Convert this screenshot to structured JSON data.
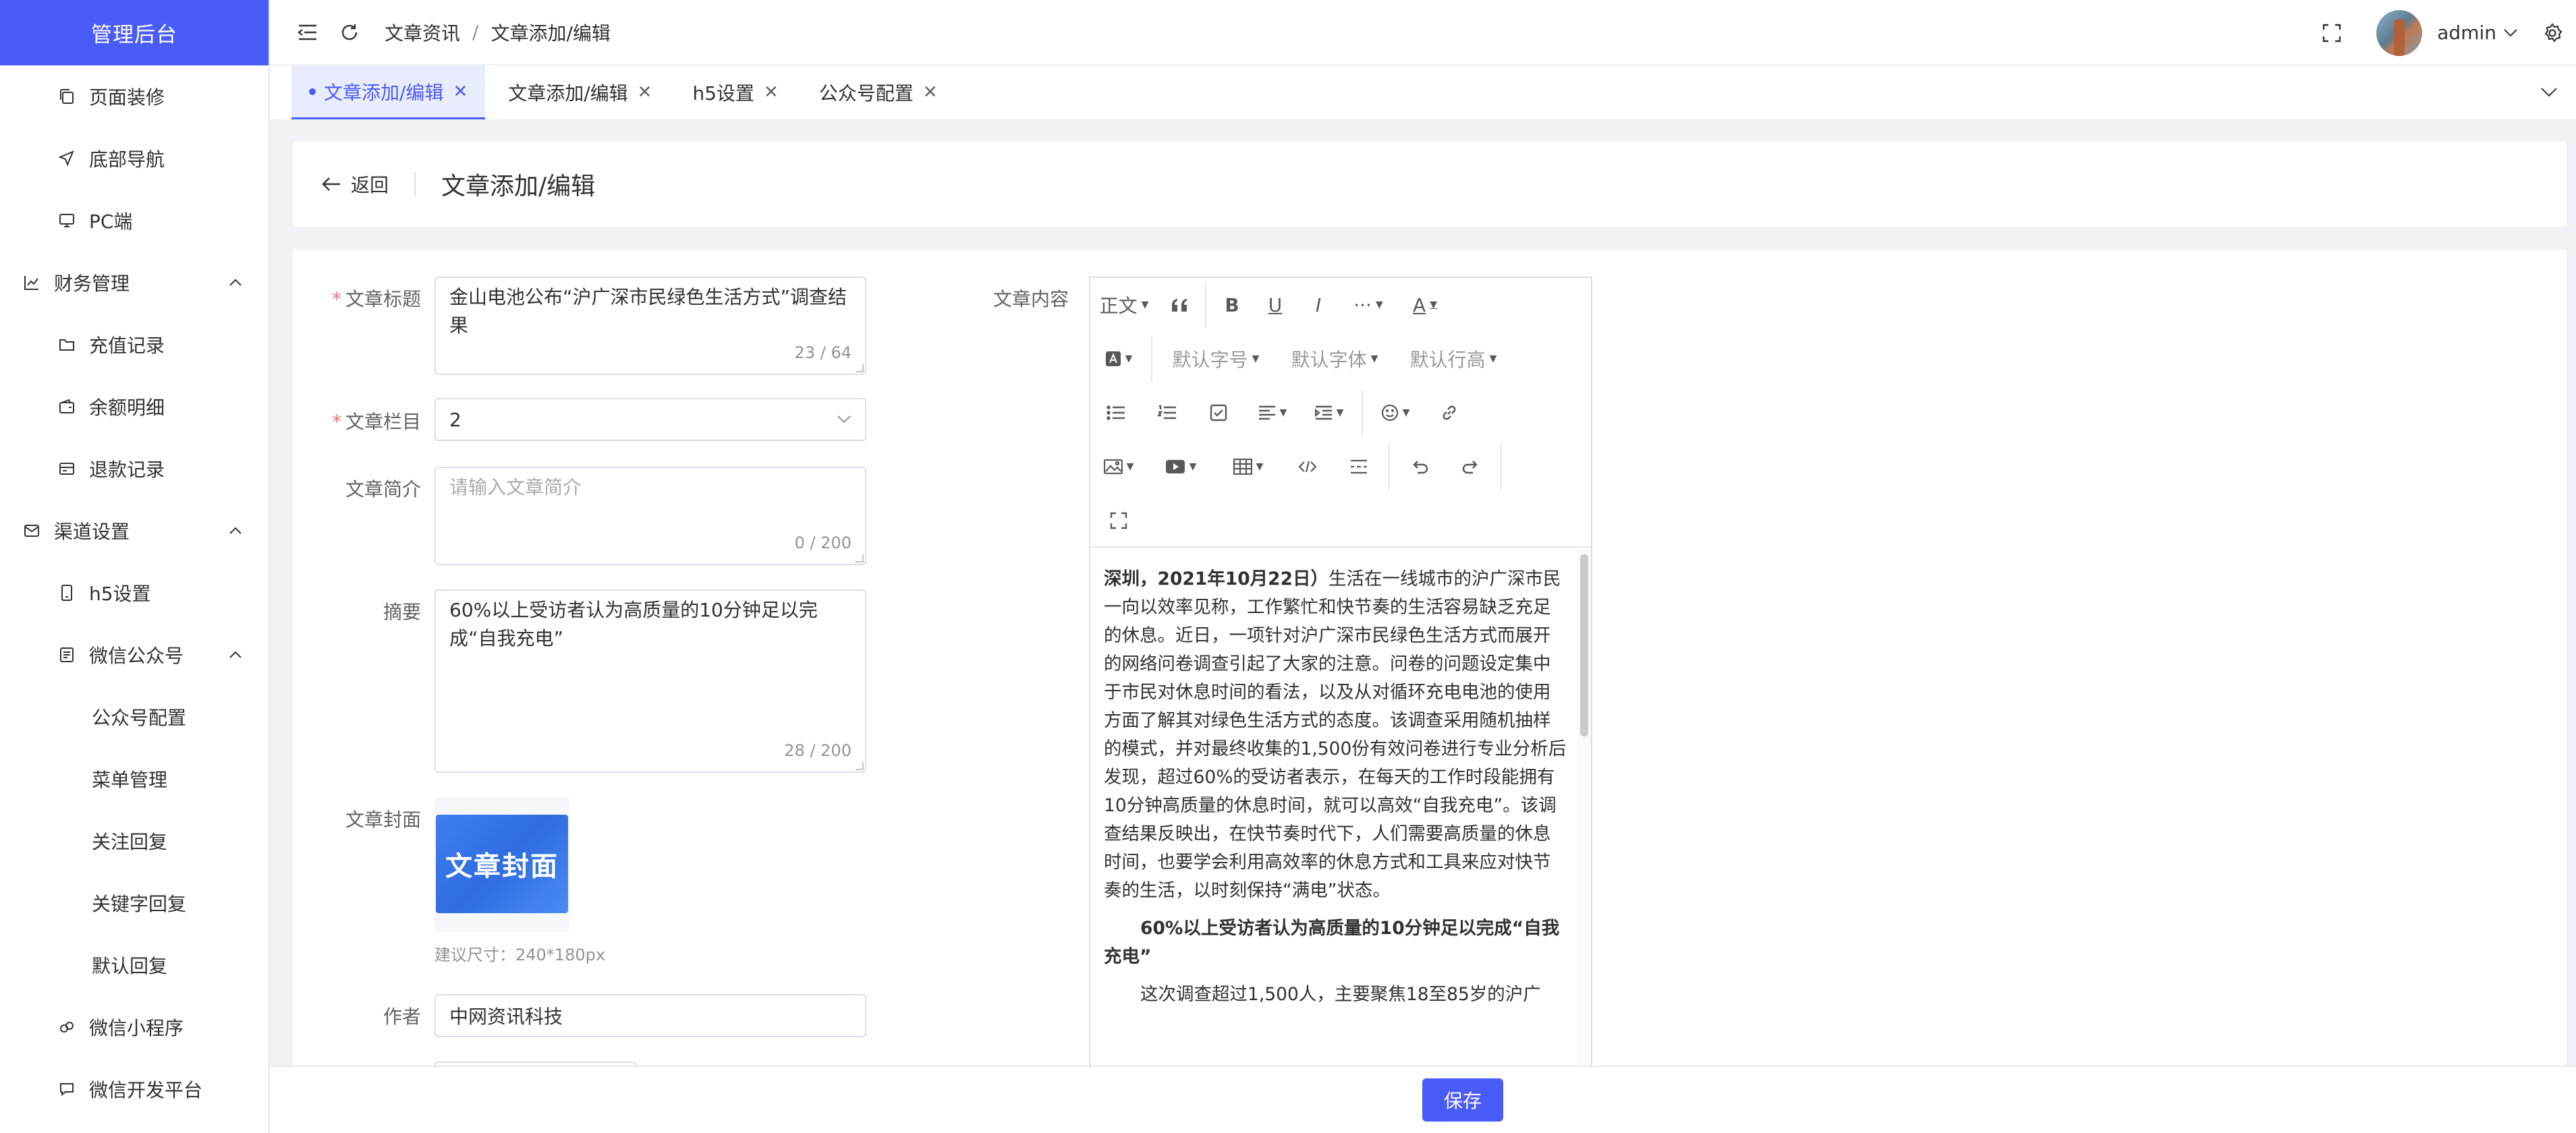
{
  "brand": {
    "title": "管理后台"
  },
  "sidebar": {
    "items": [
      {
        "label": "页面装修",
        "icon": "copy-icon",
        "level": 2
      },
      {
        "label": "底部导航",
        "icon": "navigation-icon",
        "level": 2
      },
      {
        "label": "PC端",
        "icon": "monitor-icon",
        "level": 2
      },
      {
        "label": "财务管理",
        "icon": "chart-icon",
        "level": 1,
        "expanded": true
      },
      {
        "label": "充值记录",
        "icon": "folder-icon",
        "level": 2
      },
      {
        "label": "余额明细",
        "icon": "wallet-icon",
        "level": 2
      },
      {
        "label": "退款记录",
        "icon": "card-icon",
        "level": 2
      },
      {
        "label": "渠道设置",
        "icon": "mail-icon",
        "level": 1,
        "expanded": true
      },
      {
        "label": "h5设置",
        "icon": "mobile-icon",
        "level": 2
      },
      {
        "label": "微信公众号",
        "icon": "document-icon",
        "level": 2,
        "expanded": true
      },
      {
        "label": "公众号配置",
        "level": 3
      },
      {
        "label": "菜单管理",
        "level": 3
      },
      {
        "label": "关注回复",
        "level": 3
      },
      {
        "label": "关键字回复",
        "level": 3
      },
      {
        "label": "默认回复",
        "level": 3
      },
      {
        "label": "微信小程序",
        "icon": "miniprogram-icon",
        "level": 2
      },
      {
        "label": "微信开发平台",
        "icon": "chat-icon",
        "level": 2
      }
    ]
  },
  "header": {
    "breadcrumb": [
      "文章资讯",
      "文章添加/编辑"
    ],
    "separator": "/",
    "user": "admin"
  },
  "tabs": [
    {
      "label": "文章添加/编辑",
      "active": true
    },
    {
      "label": "文章添加/编辑",
      "active": false
    },
    {
      "label": "h5设置",
      "active": false
    },
    {
      "label": "公众号配置",
      "active": false
    }
  ],
  "page": {
    "back_label": "返回",
    "title": "文章添加/编辑"
  },
  "form": {
    "title_label": "文章标题",
    "title_value": "金山电池公布“沪广深市民绿色生活方式”调查结果",
    "title_count": "23 / 64",
    "column_label": "文章栏目",
    "column_value": "2",
    "summary_intro_label": "文章简介",
    "summary_intro_placeholder": "请输入文章简介",
    "summary_intro_count": "0 / 200",
    "abstract_label": "摘要",
    "abstract_value": "60%以上受访者认为高质量的10分钟足以完成“自我充电”",
    "abstract_count": "28 / 200",
    "cover_label": "文章封面",
    "cover_text": "文章封面",
    "cover_hint": "建议尺寸：240*180px",
    "author_label": "作者",
    "author_value": "中网资讯科技",
    "content_label": "文章内容"
  },
  "editor": {
    "toolbar": {
      "paragraph": "正文",
      "font_size": "默认字号",
      "font_family": "默认字体",
      "line_height": "默认行高"
    },
    "content": {
      "lead_bold": "深圳，2021年10月22日）",
      "p1": "生活在一线城市的沪广深市民一向以效率见称，工作繁忙和快节奏的生活容易缺乏充足的休息。近日，一项针对沪广深市民绿色生活方式而展开的网络问卷调查引起了大家的注意。问卷的问题设定集中于市民对休息时间的看法，以及从对循环充电电池的使用方面了解其对绿色生活方式的态度。该调查采用随机抽样的模式，并对最终收集的1,500份有效问卷进行专业分析后发现，超过60%的受访者表示，在每天的工作时段能拥有10分钟高质量的休息时间，就可以高效“自我充电”。该调查结果反映出，在快节奏时代下，人们需要高质量的休息时间，也要学会利用高效率的休息方式和工具来应对快节奏的生活，以时刻保持“满电”状态。",
      "h2": "60%以上受访者认为高质量的10分钟足以完成“自我充电”",
      "p2": "这次调查超过1,500人，主要聚焦18至85岁的沪广"
    }
  },
  "footer": {
    "save_label": "保存"
  },
  "colors": {
    "accent": "#4a5cf7",
    "required": "#f56c6c"
  }
}
